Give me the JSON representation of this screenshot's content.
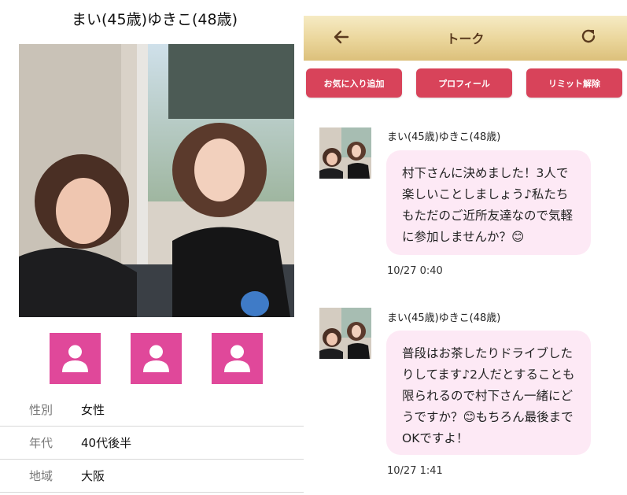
{
  "profile": {
    "name": "まい(45歳)ゆきこ(48歳)",
    "details": [
      {
        "label": "性別",
        "value": "女性"
      },
      {
        "label": "年代",
        "value": "40代後半"
      },
      {
        "label": "地域",
        "value": "大阪"
      }
    ]
  },
  "chat": {
    "title": "トーク",
    "buttons": {
      "favorite": "お気に入り追加",
      "profile": "プロフィール",
      "limit": "リミット解除"
    },
    "messages": [
      {
        "sender": "まい(45歳)ゆきこ(48歳)",
        "text": "村下さんに決めました！3人で楽しいことしましょう♪私たちもただのご近所友達なので気軽に参加しませんか？😊",
        "time": "10/27 0:40"
      },
      {
        "sender": "まい(45歳)ゆきこ(48歳)",
        "text": "普段はお茶したりドライブしたりしてます♪2人だとすることも限られるので村下さん一緒にどうですか？😊もちろん最後までOKですよ！",
        "time": "10/27 1:41"
      }
    ]
  },
  "colors": {
    "accent_pink": "#e0489a",
    "button_red": "#d8435a",
    "bubble": "#fde9f5",
    "header_gold": "#ead59a"
  },
  "icons": [
    "person-icon",
    "back-arrow-icon",
    "refresh-icon"
  ]
}
